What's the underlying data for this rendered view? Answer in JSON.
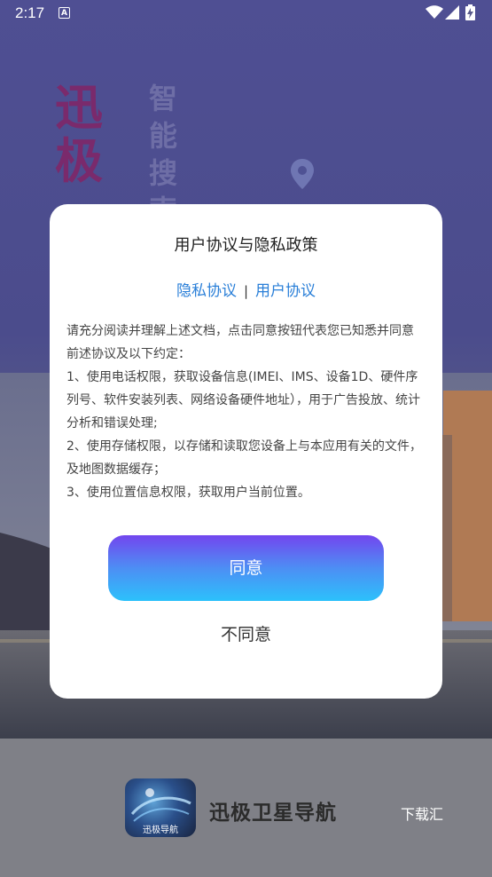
{
  "status_bar": {
    "time": "2:17",
    "notification_icon": "a-badge-icon",
    "wifi_icon": "wifi-icon",
    "signal_icon": "signal-icon",
    "battery_icon": "battery-charging-icon"
  },
  "splash": {
    "title": "迅极",
    "subtitle": "智能搜索"
  },
  "dialog": {
    "title": "用户协议与隐私政策",
    "link_privacy": "隐私协议",
    "link_separator": "|",
    "link_user": "用户协议",
    "body_intro": "请充分阅读并理解上述文档，点击同意按钮代表您已知悉并同意前述协议及以下约定：",
    "body_item1": "1、使用电话权限，获取设备信息(IMEI、IMS、设备1D、硬件序列号、软件安装列表、网络设备硬件地址），用于广告投放、统计分析和错误处理;",
    "body_item2": "2、使用存储权限，以存储和读取您设备上与本应用有关的文件，及地图数据缓存；",
    "body_item3": "3、使用位置信息权限，获取用户当前位置。",
    "agree_label": "同意",
    "disagree_label": "不同意"
  },
  "bottom_bar": {
    "app_icon_label": "迅极导航",
    "app_name": "迅极卫星导航",
    "source": "下载汇"
  },
  "colors": {
    "link": "#2a7fd8",
    "button_top": "#7346ee",
    "button_bottom": "#2cc1fb"
  }
}
